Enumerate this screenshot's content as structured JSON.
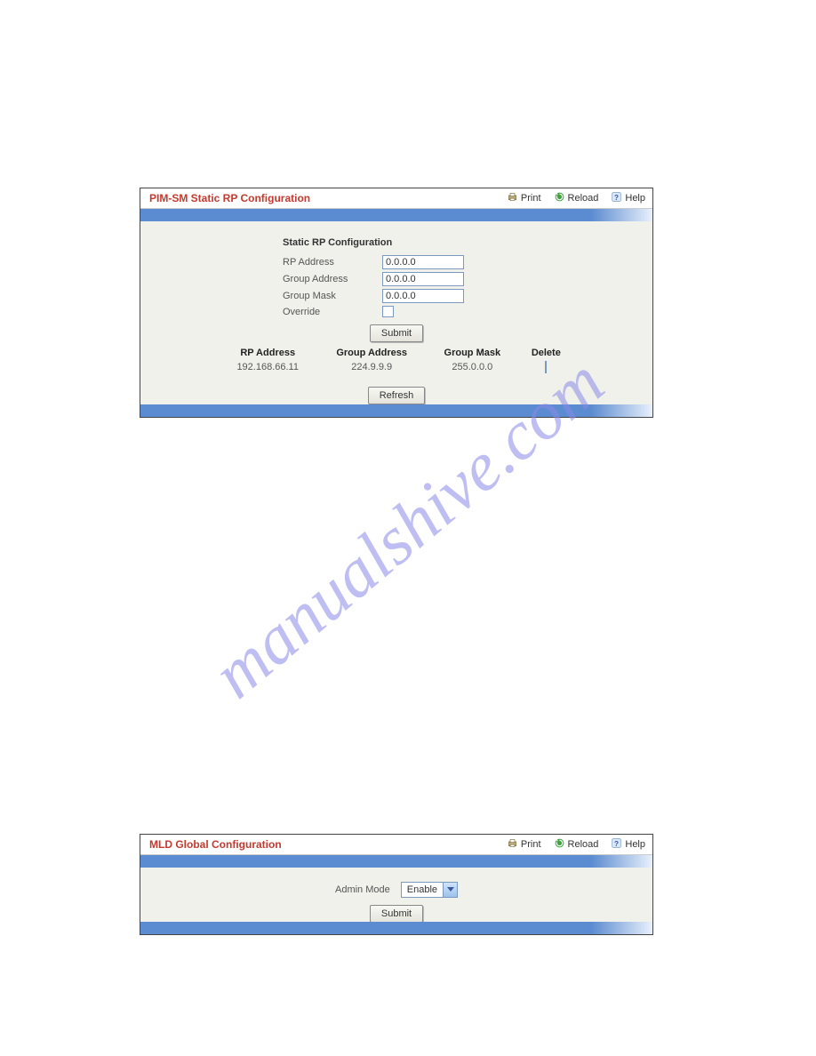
{
  "watermark": "manualshive.com",
  "actions": {
    "print": "Print",
    "reload": "Reload",
    "help": "Help"
  },
  "panel1": {
    "title": "PIM-SM Static RP Configuration",
    "section_title": "Static RP Configuration",
    "labels": {
      "rp_address": "RP Address",
      "group_address": "Group Address",
      "group_mask": "Group Mask",
      "override": "Override"
    },
    "values": {
      "rp_address": "0.0.0.0",
      "group_address": "0.0.0.0",
      "group_mask": "0.0.0.0"
    },
    "buttons": {
      "submit": "Submit",
      "refresh": "Refresh"
    },
    "table": {
      "headers": {
        "rp_address": "RP Address",
        "group_address": "Group Address",
        "group_mask": "Group Mask",
        "delete": "Delete"
      },
      "rows": [
        {
          "rp_address": "192.168.66.11",
          "group_address": "224.9.9.9",
          "group_mask": "255.0.0.0"
        }
      ]
    }
  },
  "panel2": {
    "title": "MLD Global Configuration",
    "labels": {
      "admin_mode": "Admin Mode"
    },
    "values": {
      "admin_mode": "Enable"
    },
    "buttons": {
      "submit": "Submit"
    }
  }
}
